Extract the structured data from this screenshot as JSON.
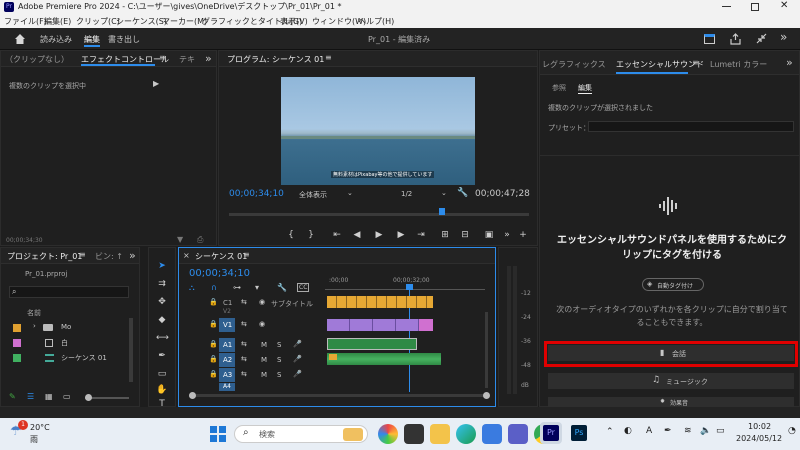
{
  "window": {
    "title": "Adobe Premiere Pro 2024 - C:\\ユーザー\\gives\\OneDrive\\デスクトップ\\Pr_01\\Pr_01 *",
    "app_icon": "Pr"
  },
  "menu": [
    "ファイル(F)",
    "編集(E)",
    "クリップ(C)",
    "シーケンス(S)",
    "マーカー(M)",
    "グラフィックとタイトル(G)",
    "表示(V)",
    "ウィンドウ(W)",
    "ヘルプ(H)"
  ],
  "workspace": {
    "tabs": [
      "読み込み",
      "編集",
      "書き出し"
    ],
    "project_title": "Pr_01 - 編集済み"
  },
  "effect_controls": {
    "tab_source": "（クリップなし）",
    "tab_effect": "エフェクトコントロール",
    "tab_extra": "テキ",
    "message": "複数のクリップを選択中",
    "timecode": "00;00;34;30"
  },
  "program_monitor": {
    "title": "プログラム: シーケンス 01",
    "caption": "無料素材はPixabay等の他で提供しています",
    "current_time": "00;00;34;10",
    "fit": "全体表示",
    "resolution": "1/2",
    "duration": "00;00;47;28"
  },
  "project_panel": {
    "tab": "プロジェクト: Pr_01",
    "tab2": "ビン: ↑",
    "file": "Pr_01.prproj",
    "column_name": "名前",
    "items": [
      {
        "name": "Mo",
        "color": "#e0a030",
        "type": "folder"
      },
      {
        "name": "白",
        "color": "#d070d0",
        "type": "clip"
      },
      {
        "name": "シーケンス 01",
        "color": "#40b060",
        "type": "sequence"
      }
    ]
  },
  "timeline": {
    "tab": "シーケンス 01",
    "timecode": "00;00;34;10",
    "ruler": [
      ":00;00",
      "00;00;32;00"
    ],
    "video_tracks": [
      "C1",
      "V2",
      "V1"
    ],
    "audio_tracks": [
      "A1",
      "A2",
      "A3",
      "A4"
    ],
    "caption_label": "サブタイトル",
    "m_label": "M",
    "s_label": "S"
  },
  "meter": {
    "scale": [
      "-12",
      "-24",
      "-36",
      "-48",
      "dB"
    ]
  },
  "essential_sound": {
    "tab_graphics": "レグラフィックス",
    "tab_sound": "エッセンシャルサウンド",
    "tab_lumetri": "Lumetri カラー",
    "sub_browse": "参照",
    "sub_edit": "編集",
    "status": "複数のクリップが選択されました",
    "preset_label": "プリセット：",
    "headline": "エッセンシャルサウンドパネルを使用するためにクリップにタグを付ける",
    "auto_tag": "自動タグ付け",
    "desc": "次のオーディオタイプのいずれかを各クリップに自分で割り当てることもできます。",
    "types": [
      "会話",
      "ミュージック",
      "効果音"
    ],
    "highlight_color": "#e00000"
  },
  "taskbar": {
    "weather_temp": "20°C",
    "weather_cond": "雨",
    "weather_badge": "1",
    "search": "検索",
    "time": "10:02",
    "date": "2024/05/12",
    "ime": "A"
  }
}
